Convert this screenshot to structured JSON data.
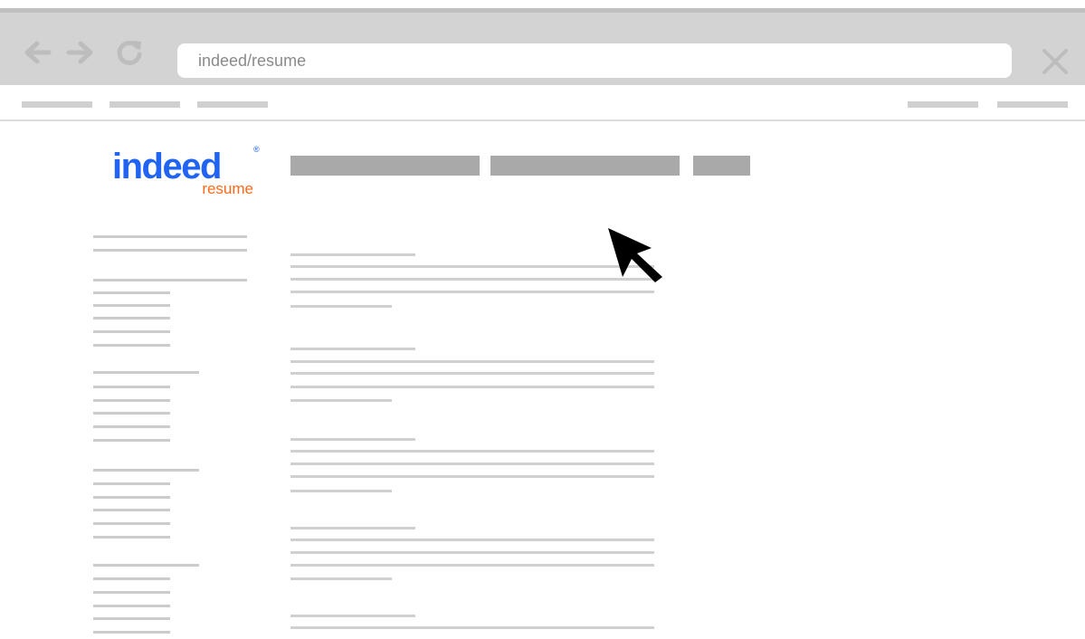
{
  "browser": {
    "back_icon": "arrow-left-icon",
    "forward_icon": "arrow-right-icon",
    "reload_icon": "reload-icon",
    "close_icon": "close-x-icon",
    "url": "indeed/resume"
  },
  "logo": {
    "word": "indeed",
    "sub": "resume",
    "reg": "®",
    "brand_blue": "#2164f3",
    "brand_orange": "#ff6a19"
  },
  "cursor_icon": "mouse-pointer-icon"
}
